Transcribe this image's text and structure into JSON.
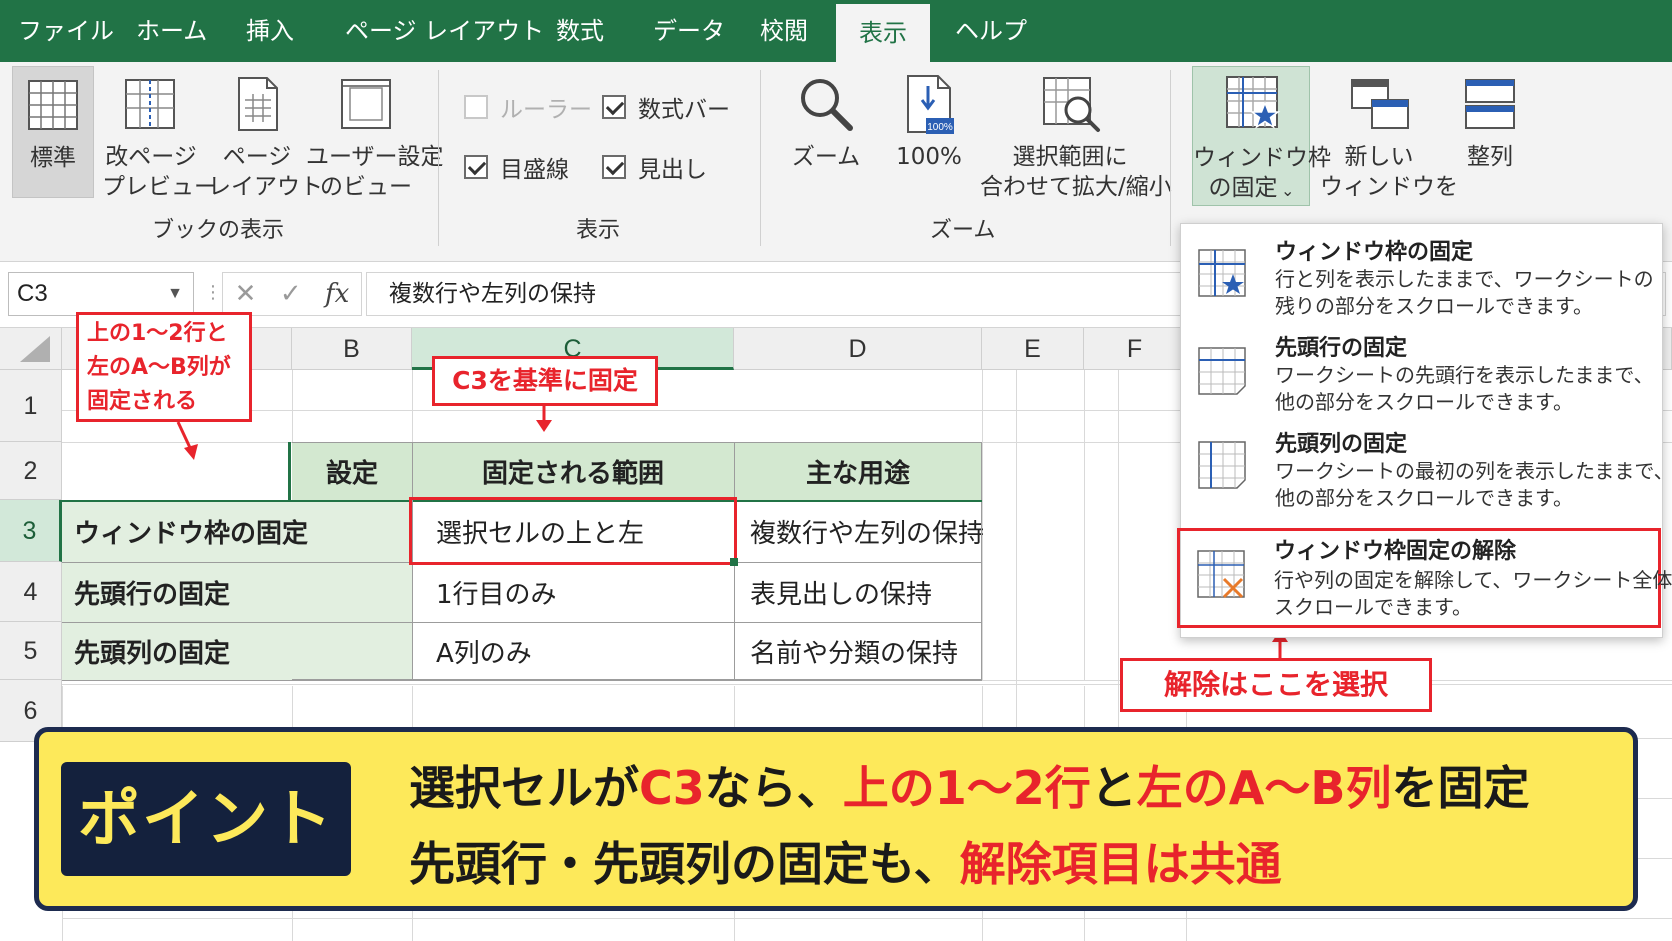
{
  "menu": {
    "tabs": [
      "ファイル",
      "ホーム",
      "挿入",
      "ページ レイアウト",
      "数式",
      "データ",
      "校閲",
      "表示",
      "ヘルプ"
    ],
    "active_tab": "表示"
  },
  "ribbon": {
    "book_view": {
      "group_label": "ブックの表示",
      "normal": "標準",
      "page_break": [
        "改ページ",
        "プレビュー"
      ],
      "page_layout": [
        "ページ",
        "レイアウト"
      ],
      "custom_views": [
        "ユーザー設定",
        "のビュー"
      ]
    },
    "show": {
      "group_label": "表示",
      "ruler": "ルーラー",
      "formula_bar": "数式バー",
      "gridlines": "目盛線",
      "headings": "見出し",
      "ruler_checked": false,
      "formula_bar_checked": true,
      "gridlines_checked": true,
      "headings_checked": true
    },
    "zoom": {
      "group_label": "ズーム",
      "zoom": "ズーム",
      "hundred": "100%",
      "hundred_icon_text": "100%",
      "zoom_to_selection": [
        "選択範囲に",
        "合わせて拡大/縮小"
      ]
    },
    "window": {
      "freeze_panes": [
        "ウィンドウ枠",
        "の固定"
      ],
      "new_window": [
        "新しい",
        "ウィンドウを"
      ],
      "arrange": "整列"
    }
  },
  "formula_bar": {
    "name_box": "C3",
    "fx": "fx",
    "cancel": "✕",
    "enter": "✓",
    "formula": "複数行や左列の保持"
  },
  "sheet": {
    "columns": [
      "B",
      "C",
      "D",
      "E",
      "F"
    ],
    "rows": [
      "1",
      "2",
      "3",
      "4",
      "5",
      "6"
    ],
    "selected_column": "C",
    "selected_row": "3",
    "table_header": [
      "設定",
      "固定される範囲",
      "主な用途"
    ],
    "table_rows": [
      {
        "setting": "ウィンドウ枠の固定",
        "range": "選択セルの上と左",
        "use": "複数行や左列の保持"
      },
      {
        "setting": "先頭行の固定",
        "range": "1行目のみ",
        "use": "表見出しの保持"
      },
      {
        "setting": "先頭列の固定",
        "range": "A列のみ",
        "use": "名前や分類の保持"
      }
    ]
  },
  "callouts": {
    "frozen_area": [
      "上の1〜2行と",
      "左のA〜B列が",
      "固定される"
    ],
    "c3_base": "C3を基準に固定",
    "unfreeze_here": "解除はここを選択"
  },
  "dropdown": {
    "items": [
      {
        "title": "ウィンドウ枠の固定",
        "desc": [
          "行と列を表示したままで、ワークシートの",
          "残りの部分をスクロールできます。"
        ],
        "icon": "freeze-panes-icon"
      },
      {
        "title": "先頭行の固定",
        "desc": [
          "ワークシートの先頭行を表示したままで、",
          "他の部分をスクロールできます。"
        ],
        "icon": "freeze-top-row-icon"
      },
      {
        "title": "先頭列の固定",
        "desc": [
          "ワークシートの最初の列を表示したままで、",
          "他の部分をスクロールできます。"
        ],
        "icon": "freeze-first-column-icon"
      },
      {
        "title": "ウィンドウ枠固定の解除",
        "desc": [
          "行や列の固定を解除して、ワークシート全体を",
          "スクロールできます。"
        ],
        "icon": "unfreeze-panes-icon"
      }
    ]
  },
  "point": {
    "badge": "ポイント",
    "line1": [
      "選択セルが",
      "C3",
      "なら、",
      "上の1〜2行",
      "と",
      "左のA〜B列",
      "を固定"
    ],
    "line2": [
      "先頭行・先頭列の固定も、",
      "解除項目は共通"
    ]
  },
  "colors": {
    "excel_green": "#217346",
    "accent_red": "#e8242c",
    "point_yellow": "#fde95a",
    "navy": "#14213d"
  }
}
